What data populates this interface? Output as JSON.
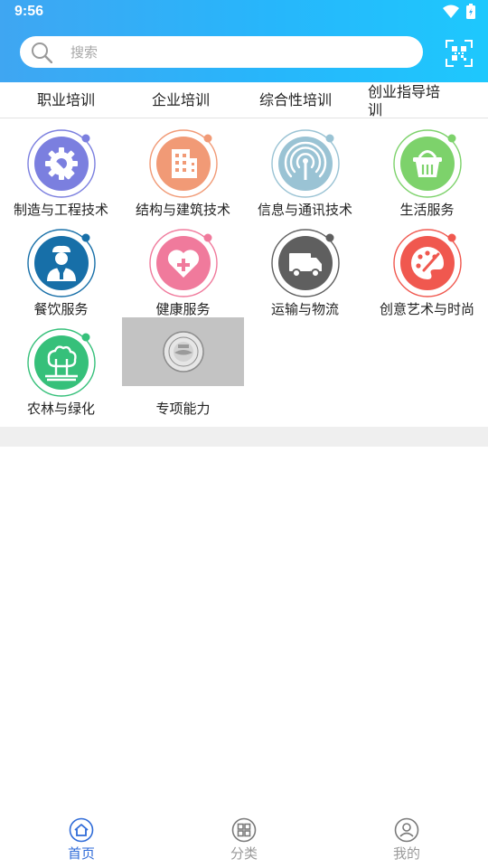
{
  "status_bar": {
    "time": "9:56",
    "wifi_icon": "wifi-icon",
    "battery_icon": "battery-icon"
  },
  "header": {
    "search_placeholder": "搜索",
    "search_icon": "search-icon",
    "scan_icon": "qr-scan-icon"
  },
  "tabs": [
    {
      "label": "职业培训"
    },
    {
      "label": "企业培训"
    },
    {
      "label": "综合性培训"
    },
    {
      "label": "创业指导培训"
    }
  ],
  "categories": [
    {
      "label": "制造与工程技术",
      "icon": "tools-gear-icon",
      "color": "#7b7fdf",
      "dot": "#7b7fdf"
    },
    {
      "label": "结构与建筑技术",
      "icon": "building-icon",
      "color": "#f19a76",
      "dot": "#f19a76"
    },
    {
      "label": "信息与通讯技术",
      "icon": "signal-antenna-icon",
      "color": "#9ac3d4",
      "dot": "#9ac3d4"
    },
    {
      "label": "生活服务",
      "icon": "basket-icon",
      "color": "#7dd26b",
      "dot": "#7dd26b"
    },
    {
      "label": "餐饮服务",
      "icon": "chef-icon",
      "color": "#176fa8",
      "dot": "#176fa8"
    },
    {
      "label": "健康服务",
      "icon": "heart-plus-icon",
      "color": "#f07a9c",
      "dot": "#f07a9c"
    },
    {
      "label": "运输与物流",
      "icon": "truck-icon",
      "color": "#5f5f5f",
      "dot": "#5f5f5f"
    },
    {
      "label": "创意艺术与时尚",
      "icon": "palette-icon",
      "color": "#f0584f",
      "dot": "#f0584f"
    },
    {
      "label": "农林与绿化",
      "icon": "trees-icon",
      "color": "#36c07a",
      "dot": "#36c07a"
    },
    {
      "label": "专项能力",
      "icon": "seal-logo-icon",
      "color": "#c3c3c3",
      "dot": ""
    }
  ],
  "bottom_nav": [
    {
      "label": "首页",
      "icon": "home-icon",
      "color": "#2f6bd8"
    },
    {
      "label": "分类",
      "icon": "category-icon",
      "color": "#9a9a9a"
    },
    {
      "label": "我的",
      "icon": "profile-icon",
      "color": "#9a9a9a"
    }
  ]
}
